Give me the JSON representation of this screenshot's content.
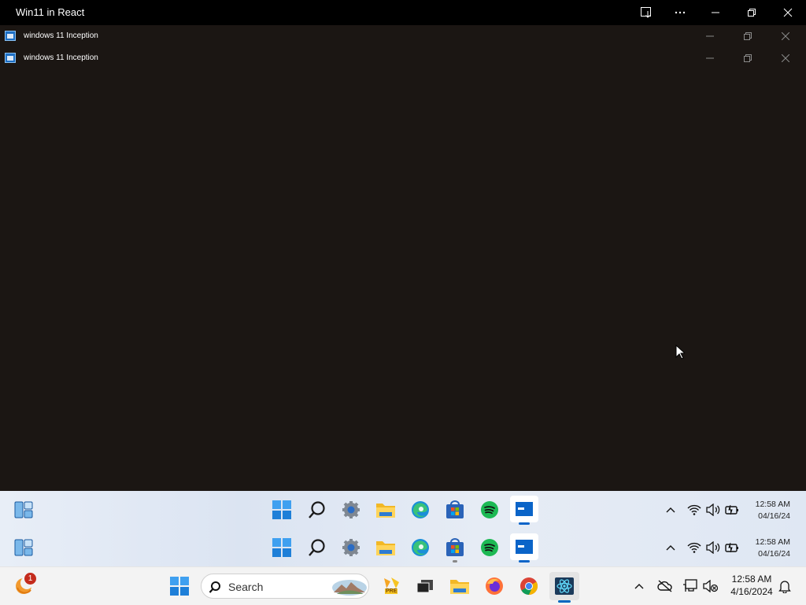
{
  "app": {
    "title": "Win11 in React"
  },
  "windows": [
    {
      "title": "windows 11 Inception"
    },
    {
      "title": "windows 11 Inception"
    }
  ],
  "inner_taskbars": [
    {
      "time": "12:58 AM",
      "date": "04/16/24"
    },
    {
      "time": "12:58 AM",
      "date": "04/16/24"
    }
  ],
  "taskbar": {
    "weather_badge": "1",
    "search_placeholder": "Search",
    "store_badge": "PRE",
    "time": "12:58 AM",
    "date": "4/16/2024"
  },
  "colors": {
    "desktop": "#1b1613",
    "accent": "#0078d4",
    "spotify": "#1db954"
  }
}
